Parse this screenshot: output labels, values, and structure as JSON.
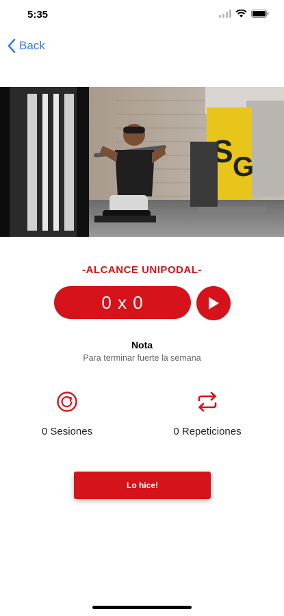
{
  "status_bar": {
    "time": "5:35"
  },
  "nav": {
    "back_label": "Back"
  },
  "exercise": {
    "title": "-ALCANCE UNIPODAL-",
    "counter": "0 x 0"
  },
  "note": {
    "title": "Nota",
    "text": "Para terminar fuerte la semana"
  },
  "stats": {
    "sessions_label": "0 Sesiones",
    "repetitions_label": "0 Repeticiones"
  },
  "actions": {
    "done_label": "Lo hice!"
  },
  "icons": {
    "back": "chevron-left-icon",
    "play": "play-icon",
    "sessions": "refresh-circle-icon",
    "repetitions": "repeat-icon",
    "wifi": "wifi-icon",
    "battery": "battery-icon",
    "signal": "signal-icon"
  },
  "colors": {
    "accent": "#d6121a",
    "link": "#3478f6",
    "muted_text": "#666666"
  }
}
